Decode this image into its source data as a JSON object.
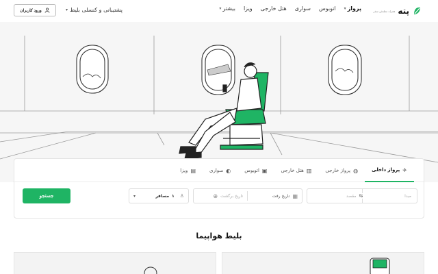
{
  "header": {
    "logo_text": "پته",
    "logo_subtitle": "همراه مطمئن سفر",
    "nav": [
      {
        "label": "پرواز",
        "active": true,
        "dropdown": true
      },
      {
        "label": "اتوبوس",
        "active": false,
        "dropdown": false
      },
      {
        "label": "سواری",
        "active": false,
        "dropdown": false
      },
      {
        "label": "هتل خارجی",
        "active": false,
        "dropdown": false
      },
      {
        "label": "ویزا",
        "active": false,
        "dropdown": false
      },
      {
        "label": "بیشتر",
        "active": false,
        "dropdown": true
      }
    ],
    "support_label": "پشتیبانی و کنسلی بلیط",
    "login_label": "ورود کاربران"
  },
  "tabs": [
    {
      "label": "پرواز داخلی",
      "icon": "plane-icon",
      "active": true
    },
    {
      "label": "پرواز خارجی",
      "icon": "globe-icon",
      "active": false
    },
    {
      "label": "هتل خارجی",
      "icon": "building-icon",
      "active": false
    },
    {
      "label": "اتوبوس",
      "icon": "bus-icon",
      "active": false
    },
    {
      "label": "سواری",
      "icon": "car-icon",
      "active": false
    },
    {
      "label": "ویزا",
      "icon": "passport-icon",
      "active": false
    }
  ],
  "search": {
    "origin_placeholder": "مبدا",
    "destination_placeholder": "مقصد",
    "depart_placeholder": "تاریخ رفت",
    "return_placeholder": "تاریخ برگشت",
    "passengers_value": "۱",
    "passengers_label": "مسافر",
    "button_label": "جستجو"
  },
  "section_title": "بلیط هواپیما",
  "colors": {
    "accent": "#1fb464",
    "hero_bg": "#f6f6f6"
  }
}
